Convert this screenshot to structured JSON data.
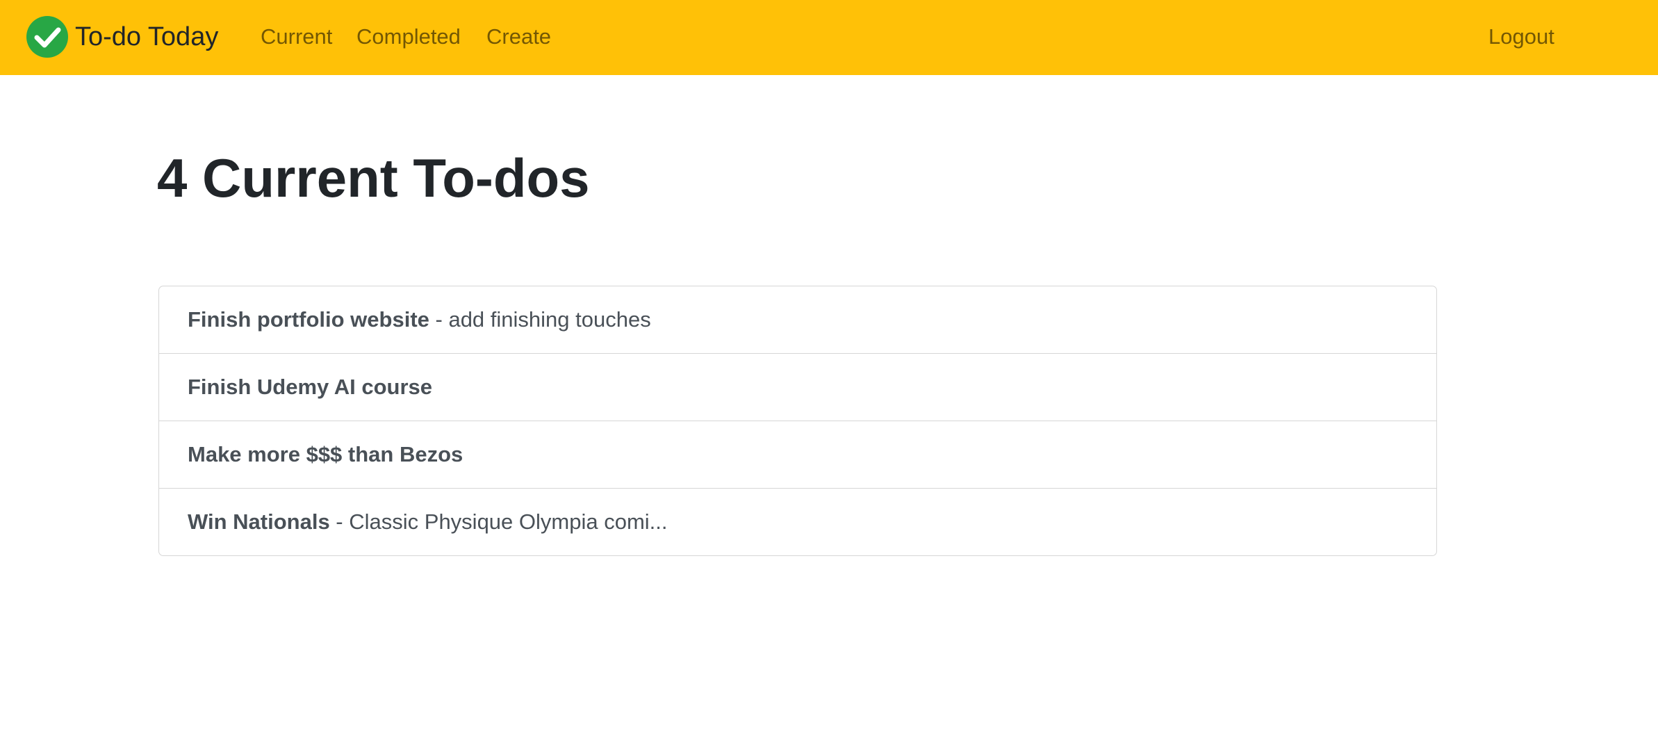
{
  "navbar": {
    "brand": "To-do Today",
    "logo_icon": "check-circle-icon",
    "logo_color": "#28a745",
    "background": "#ffc107",
    "links": {
      "current": "Current",
      "completed": "Completed",
      "create": "Create",
      "logout": "Logout"
    }
  },
  "main": {
    "title": "4 Current To-dos",
    "todos": [
      {
        "title": "Finish portfolio website",
        "separator": " - ",
        "memo": "add finishing touches"
      },
      {
        "title": "Finish Udemy AI course",
        "separator": "",
        "memo": ""
      },
      {
        "title": "Make more $$$ than Bezos",
        "separator": "",
        "memo": ""
      },
      {
        "title": "Win Nationals",
        "separator": " - ",
        "memo": "Classic Physique Olympia comi..."
      }
    ]
  }
}
